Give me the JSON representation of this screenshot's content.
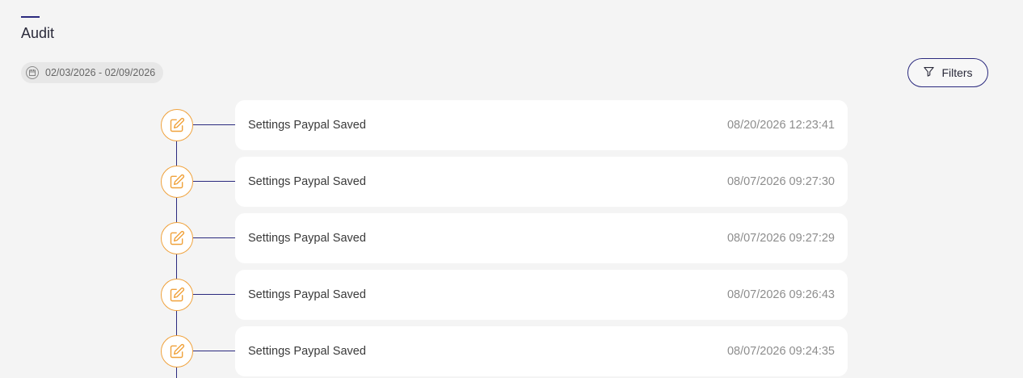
{
  "page": {
    "title": "Audit"
  },
  "date_range": {
    "label": "02/03/2026 - 02/09/2026",
    "icon": "calendar-icon"
  },
  "filters": {
    "label": "Filters",
    "icon": "filter-icon"
  },
  "colors": {
    "accent": "#2b2a7e",
    "node": "#f0a23c",
    "background": "#f4f4f4"
  },
  "events": [
    {
      "description": "Settings Paypal Saved",
      "timestamp": "08/20/2026 12:23:41",
      "icon": "edit-icon"
    },
    {
      "description": "Settings Paypal Saved",
      "timestamp": "08/07/2026 09:27:30",
      "icon": "edit-icon"
    },
    {
      "description": "Settings Paypal Saved",
      "timestamp": "08/07/2026 09:27:29",
      "icon": "edit-icon"
    },
    {
      "description": "Settings Paypal Saved",
      "timestamp": "08/07/2026 09:26:43",
      "icon": "edit-icon"
    },
    {
      "description": "Settings Paypal Saved",
      "timestamp": "08/07/2026 09:24:35",
      "icon": "edit-icon"
    }
  ]
}
